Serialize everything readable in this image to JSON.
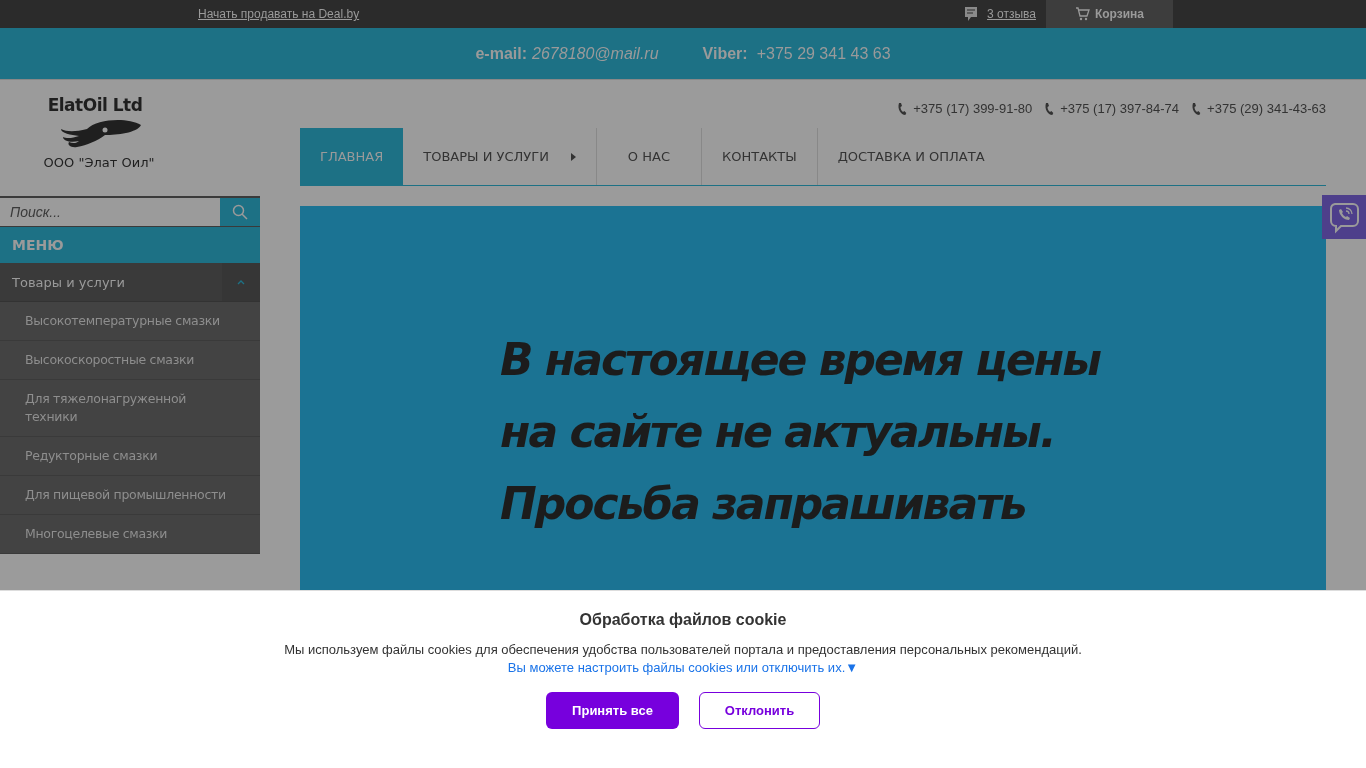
{
  "top_bar": {
    "sell_link": "Начать продавать на Deal.by",
    "reviews_link": "3 отзыва",
    "cart_button": "Корзина"
  },
  "contact_band": {
    "email_label": "e-mail:",
    "email": "2678180@mail.ru",
    "viber_label": "Viber:",
    "viber": "+375 29 341 43 63"
  },
  "logo": {
    "title": "ElatOil Ltd",
    "company": "ООО \"Элат Оил\""
  },
  "phones": [
    "+375 (17) 399-91-80",
    "+375 (17) 397-84-74",
    "+375 (29) 341-43-63"
  ],
  "nav": [
    {
      "label": "ГЛАВНАЯ",
      "selected": true,
      "submenu": false
    },
    {
      "label": "ТОВАРЫ И УСЛУГИ",
      "selected": false,
      "submenu": true
    },
    {
      "label": "О НАС",
      "selected": false,
      "submenu": false
    },
    {
      "label": "КОНТАКТЫ",
      "selected": false,
      "submenu": false
    },
    {
      "label": "ДОСТАВКА И ОПЛАТА",
      "selected": false,
      "submenu": false
    }
  ],
  "search": {
    "placeholder": "Поиск..."
  },
  "sidebar": {
    "header": "МЕНЮ",
    "items": [
      {
        "label": "Товары и услуги",
        "expanded": true,
        "children": [
          {
            "label": "Высокотемпературные смазки"
          },
          {
            "label": "Высокоскоростные смазки"
          },
          {
            "label": "Для тяжелонагруженной техники"
          },
          {
            "label": "Редукторные смазки"
          },
          {
            "label": "Для пищевой промышленности"
          },
          {
            "label": "Многоцелевые смазки"
          }
        ]
      }
    ]
  },
  "banner": {
    "lines": [
      "В настоящее время цены",
      "на сайте не актуальны.",
      "Просьба запрашивать"
    ]
  },
  "cookie_notice": {
    "title": "Обработка файлов cookie",
    "text": "Мы используем файлы cookies для обеспечения удобства пользователей портала и предоставления персональных рекомендаций.",
    "settings_link": "Вы можете настроить файлы cookies или отключить их.▼",
    "buttons": [
      {
        "label": "Принять все",
        "kind": "primary"
      },
      {
        "label": "Отклонить",
        "kind": "outline"
      }
    ]
  }
}
